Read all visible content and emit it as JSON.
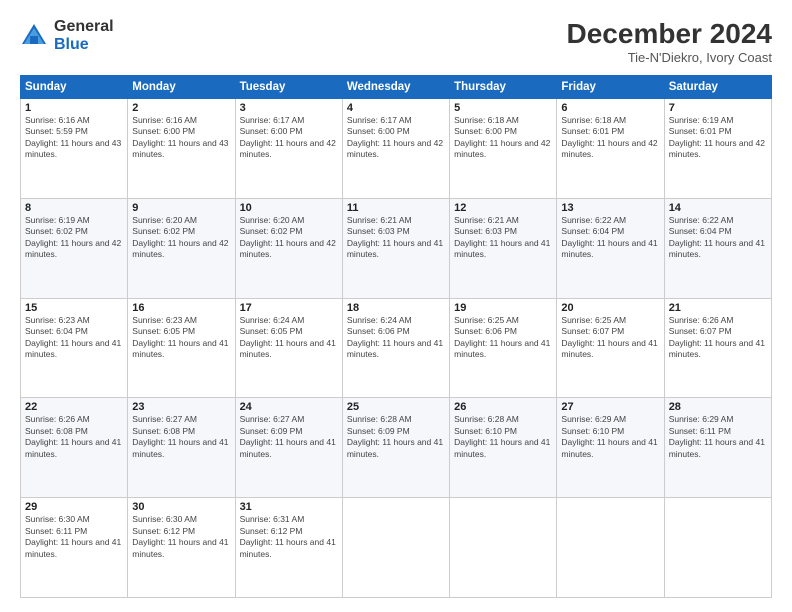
{
  "logo": {
    "general": "General",
    "blue": "Blue"
  },
  "title": "December 2024",
  "subtitle": "Tie-N'Diekro, Ivory Coast",
  "days_header": [
    "Sunday",
    "Monday",
    "Tuesday",
    "Wednesday",
    "Thursday",
    "Friday",
    "Saturday"
  ],
  "weeks": [
    [
      {
        "day": "1",
        "sunrise": "6:16 AM",
        "sunset": "5:59 PM",
        "daylight": "11 hours and 43 minutes."
      },
      {
        "day": "2",
        "sunrise": "6:16 AM",
        "sunset": "6:00 PM",
        "daylight": "11 hours and 43 minutes."
      },
      {
        "day": "3",
        "sunrise": "6:17 AM",
        "sunset": "6:00 PM",
        "daylight": "11 hours and 42 minutes."
      },
      {
        "day": "4",
        "sunrise": "6:17 AM",
        "sunset": "6:00 PM",
        "daylight": "11 hours and 42 minutes."
      },
      {
        "day": "5",
        "sunrise": "6:18 AM",
        "sunset": "6:00 PM",
        "daylight": "11 hours and 42 minutes."
      },
      {
        "day": "6",
        "sunrise": "6:18 AM",
        "sunset": "6:01 PM",
        "daylight": "11 hours and 42 minutes."
      },
      {
        "day": "7",
        "sunrise": "6:19 AM",
        "sunset": "6:01 PM",
        "daylight": "11 hours and 42 minutes."
      }
    ],
    [
      {
        "day": "8",
        "sunrise": "6:19 AM",
        "sunset": "6:02 PM",
        "daylight": "11 hours and 42 minutes."
      },
      {
        "day": "9",
        "sunrise": "6:20 AM",
        "sunset": "6:02 PM",
        "daylight": "11 hours and 42 minutes."
      },
      {
        "day": "10",
        "sunrise": "6:20 AM",
        "sunset": "6:02 PM",
        "daylight": "11 hours and 42 minutes."
      },
      {
        "day": "11",
        "sunrise": "6:21 AM",
        "sunset": "6:03 PM",
        "daylight": "11 hours and 41 minutes."
      },
      {
        "day": "12",
        "sunrise": "6:21 AM",
        "sunset": "6:03 PM",
        "daylight": "11 hours and 41 minutes."
      },
      {
        "day": "13",
        "sunrise": "6:22 AM",
        "sunset": "6:04 PM",
        "daylight": "11 hours and 41 minutes."
      },
      {
        "day": "14",
        "sunrise": "6:22 AM",
        "sunset": "6:04 PM",
        "daylight": "11 hours and 41 minutes."
      }
    ],
    [
      {
        "day": "15",
        "sunrise": "6:23 AM",
        "sunset": "6:04 PM",
        "daylight": "11 hours and 41 minutes."
      },
      {
        "day": "16",
        "sunrise": "6:23 AM",
        "sunset": "6:05 PM",
        "daylight": "11 hours and 41 minutes."
      },
      {
        "day": "17",
        "sunrise": "6:24 AM",
        "sunset": "6:05 PM",
        "daylight": "11 hours and 41 minutes."
      },
      {
        "day": "18",
        "sunrise": "6:24 AM",
        "sunset": "6:06 PM",
        "daylight": "11 hours and 41 minutes."
      },
      {
        "day": "19",
        "sunrise": "6:25 AM",
        "sunset": "6:06 PM",
        "daylight": "11 hours and 41 minutes."
      },
      {
        "day": "20",
        "sunrise": "6:25 AM",
        "sunset": "6:07 PM",
        "daylight": "11 hours and 41 minutes."
      },
      {
        "day": "21",
        "sunrise": "6:26 AM",
        "sunset": "6:07 PM",
        "daylight": "11 hours and 41 minutes."
      }
    ],
    [
      {
        "day": "22",
        "sunrise": "6:26 AM",
        "sunset": "6:08 PM",
        "daylight": "11 hours and 41 minutes."
      },
      {
        "day": "23",
        "sunrise": "6:27 AM",
        "sunset": "6:08 PM",
        "daylight": "11 hours and 41 minutes."
      },
      {
        "day": "24",
        "sunrise": "6:27 AM",
        "sunset": "6:09 PM",
        "daylight": "11 hours and 41 minutes."
      },
      {
        "day": "25",
        "sunrise": "6:28 AM",
        "sunset": "6:09 PM",
        "daylight": "11 hours and 41 minutes."
      },
      {
        "day": "26",
        "sunrise": "6:28 AM",
        "sunset": "6:10 PM",
        "daylight": "11 hours and 41 minutes."
      },
      {
        "day": "27",
        "sunrise": "6:29 AM",
        "sunset": "6:10 PM",
        "daylight": "11 hours and 41 minutes."
      },
      {
        "day": "28",
        "sunrise": "6:29 AM",
        "sunset": "6:11 PM",
        "daylight": "11 hours and 41 minutes."
      }
    ],
    [
      {
        "day": "29",
        "sunrise": "6:30 AM",
        "sunset": "6:11 PM",
        "daylight": "11 hours and 41 minutes."
      },
      {
        "day": "30",
        "sunrise": "6:30 AM",
        "sunset": "6:12 PM",
        "daylight": "11 hours and 41 minutes."
      },
      {
        "day": "31",
        "sunrise": "6:31 AM",
        "sunset": "6:12 PM",
        "daylight": "11 hours and 41 minutes."
      },
      null,
      null,
      null,
      null
    ]
  ]
}
